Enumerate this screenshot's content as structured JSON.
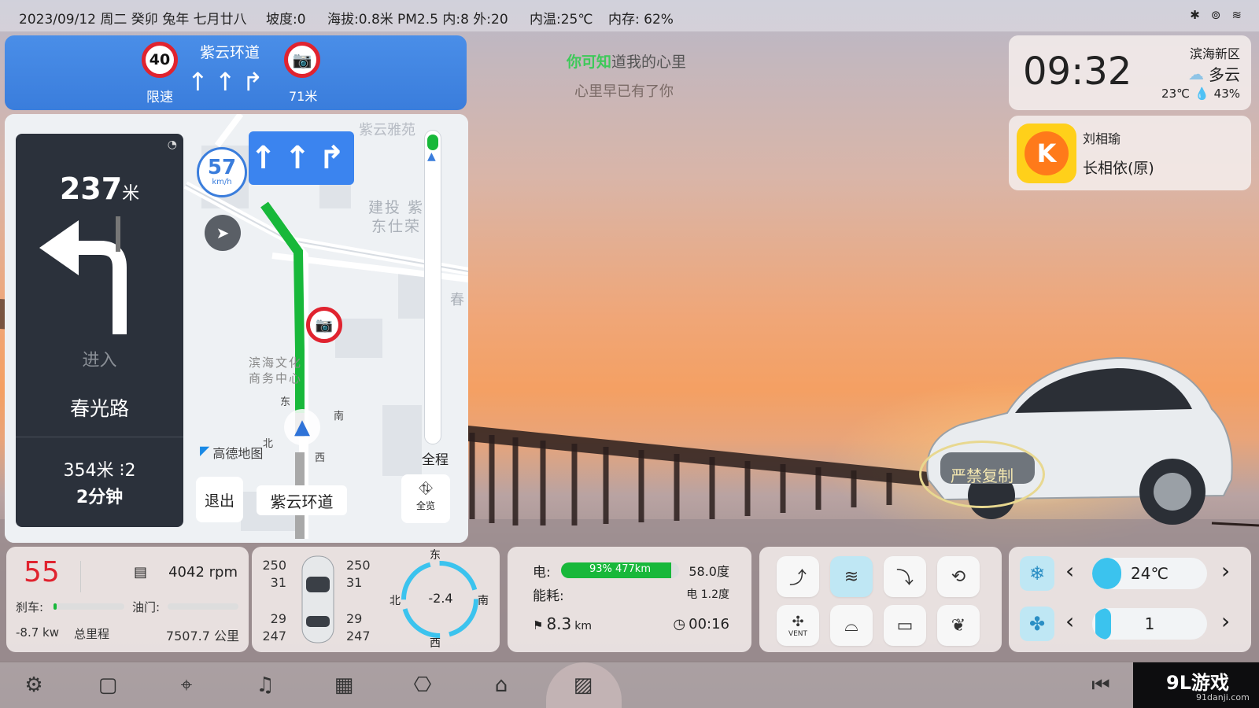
{
  "status": {
    "datetime": "2023/09/12 周二 癸卯 兔年 七月廿八",
    "slope": "坡度:0",
    "altitude": "海拔:0.8米",
    "pm25": "PM2.5 内:8 外:20",
    "inside_temp": "内温:25℃",
    "memory": "内存: 62%",
    "icons": [
      "bluetooth-icon",
      "hotspot-icon",
      "wifi-icon"
    ]
  },
  "guide": {
    "speed_limit": "40",
    "speed_limit_label": "限速",
    "road": "紫云环道",
    "camera_distance": "71米"
  },
  "lyrics": {
    "line1_highlight": "你可知",
    "line1_rest": "道我的心里",
    "line2": "心里早已有了你"
  },
  "clock": {
    "time": "09:32",
    "district": "滨海新区",
    "weather": "多云",
    "temp": "23℃",
    "humidity": "43%"
  },
  "music": {
    "artist": "刘相瑜",
    "song": "长相依(原)"
  },
  "nav": {
    "distance_num": "237",
    "distance_unit": "米",
    "enter_label": "进入",
    "next_road": "春光路",
    "remaining": "354米",
    "lights": "2",
    "eta": "2分钟",
    "current_speed": "57",
    "speed_unit": "km/h",
    "map_labels": [
      "紫云雅苑",
      "建投 紫",
      "东仕荣",
      "滨海文化",
      "商务中心",
      "春"
    ],
    "amap_label": "高德地图",
    "exit_label": "退出",
    "current_road": "紫云环道",
    "overview_label": "全览",
    "full_route_label": "全程",
    "compass": [
      "东",
      "南",
      "北",
      "西"
    ]
  },
  "watermark": "严禁复制",
  "vehicle": {
    "speed": "55",
    "rpm": "4042 rpm",
    "brake_label": "刹车:",
    "fuel_label": "油门:",
    "power": "-8.7 kw",
    "odo_label": "总里程",
    "odo_value": "7507.7 公里",
    "tire_fl_kpa": "250",
    "tire_fl_temp": "31",
    "tire_fr_kpa": "250",
    "tire_fr_temp": "31",
    "tire_rl_temp": "29",
    "tire_rl_kpa": "247",
    "tire_rr_temp": "29",
    "tire_rr_kpa": "247",
    "compass_dirs": [
      "东",
      "南",
      "西",
      "北"
    ],
    "heading_value": "-2.4"
  },
  "energy": {
    "battery_label": "电:",
    "battery_text": "93% 477km",
    "battery_fraction": 0.93,
    "battery_kwh": "58.0度",
    "consumption_label": "能耗:",
    "consumption_value": "电 1.2度",
    "trip_distance": "8.3",
    "trip_unit": "km",
    "trip_time": "00:16"
  },
  "ac": {
    "temp": "24℃",
    "temp_fraction": 0.25,
    "fan": "1",
    "fan_fraction": 0.05,
    "vent_label": "VENT"
  },
  "dock": {
    "icons": [
      "settings-icon",
      "square-icon",
      "map-pin-icon",
      "music-icon",
      "apps-icon",
      "camera-settings-icon",
      "car-icon",
      "gallery-icon",
      "back-icon"
    ]
  },
  "brand": {
    "logo": "9L游戏",
    "url": "91danji.com"
  },
  "colors": {
    "accent": "#3a7ddc",
    "speed_red": "#e0232f",
    "ac_blue": "#3bc3ee",
    "battery_green": "#18b83a"
  }
}
